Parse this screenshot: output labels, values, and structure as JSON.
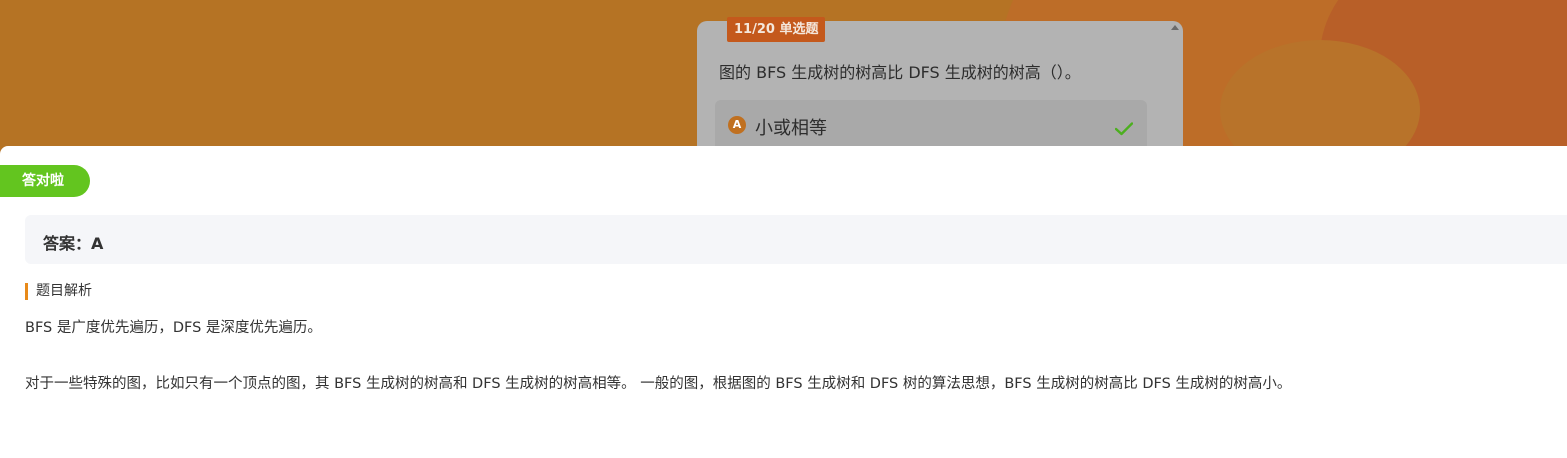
{
  "question": {
    "tag": "11/20 单选题",
    "text": "图的 BFS 生成树的树高比 DFS 生成树的树高（）。",
    "options": [
      {
        "letter": "A",
        "label": "小或相等",
        "correct": true,
        "icon": "check-icon"
      }
    ]
  },
  "result": {
    "badge": "答对啦",
    "answer": "答案：A"
  },
  "analysis": {
    "heading": "题目解析",
    "paragraphs": [
      "BFS 是广度优先遍历，DFS 是深度优先遍历。",
      "对于一些特殊的图，比如只有一个顶点的图，其 BFS 生成树的树高和 DFS 生成树的树高相等。 一般的图，根据图的 BFS 生成树和 DFS 树的算法思想，BFS 生成树的树高比 DFS 生成树的树高小。"
    ]
  },
  "colors": {
    "background": "#b57324",
    "tag": "#c4591c",
    "badge": "#63c51f",
    "accent": "#e88a1a",
    "check": "#4caf1f"
  }
}
